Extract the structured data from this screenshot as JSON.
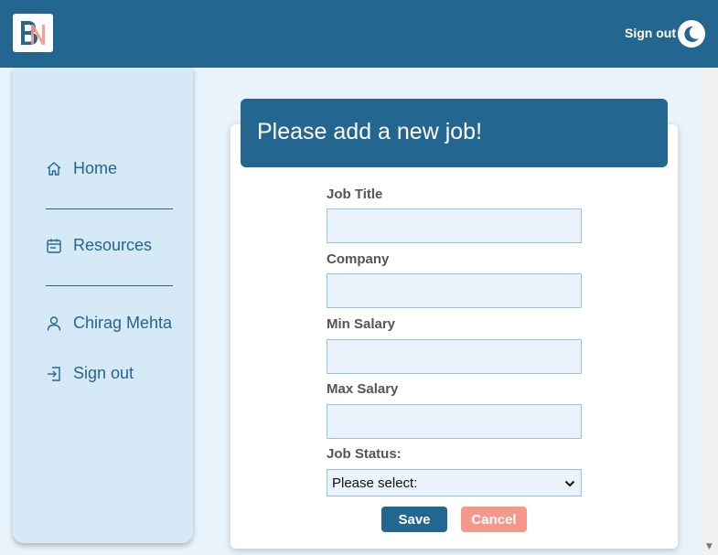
{
  "header": {
    "logo_icon": "bn-logo-icon",
    "signout_label": "Sign out",
    "theme_icon": "moon-icon"
  },
  "sidebar": {
    "items": [
      {
        "label": "Home",
        "icon": "home-icon"
      },
      {
        "label": "Resources",
        "icon": "calendar-icon"
      },
      {
        "label": "Chirag Mehta",
        "icon": "user-icon"
      },
      {
        "label": "Sign out",
        "icon": "sign-out-icon"
      }
    ]
  },
  "form": {
    "title": "Please add a new job!",
    "fields": [
      {
        "label": "Job Title",
        "value": ""
      },
      {
        "label": "Company",
        "value": ""
      },
      {
        "label": "Min Salary",
        "value": ""
      },
      {
        "label": "Max Salary",
        "value": ""
      }
    ],
    "status_label": "Job Status:",
    "status_selected": "Please select:",
    "save_label": "Save",
    "cancel_label": "Cancel"
  },
  "colors": {
    "primary": "#236690",
    "sidebar_bg": "#d6e9f7",
    "page_bg": "#e9f3fb",
    "input_bg": "#eaf3fb",
    "cancel": "#f3988a"
  }
}
